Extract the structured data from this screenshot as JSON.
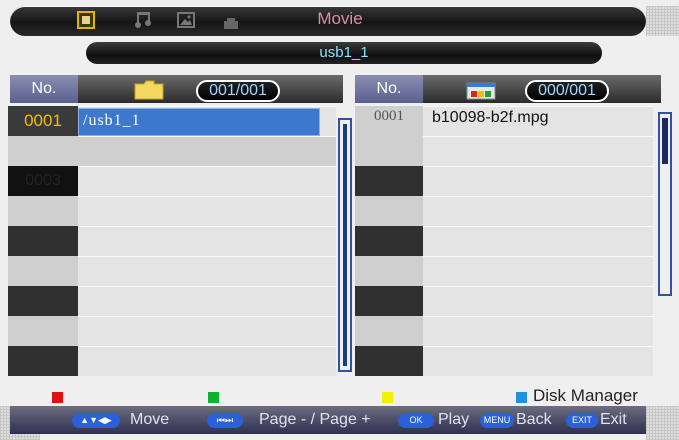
{
  "top": {
    "tabs": [
      {
        "icon": "movie-icon",
        "active": true
      },
      {
        "icon": "music-icon",
        "active": false
      },
      {
        "icon": "photo-icon",
        "active": false
      },
      {
        "icon": "text-icon",
        "active": false
      }
    ],
    "title": "Movie"
  },
  "path": "usb1_1",
  "left_panel": {
    "header_no": "No.",
    "counter": "001/001",
    "rows": [
      {
        "no": "0001",
        "name": "/usb1_1",
        "selected": true
      },
      {
        "no": "",
        "name": ""
      },
      {
        "no": "0003",
        "name": ""
      },
      {
        "no": "",
        "name": ""
      },
      {
        "no": "",
        "name": ""
      },
      {
        "no": "",
        "name": ""
      },
      {
        "no": "",
        "name": ""
      },
      {
        "no": "",
        "name": ""
      },
      {
        "no": "",
        "name": ""
      }
    ]
  },
  "right_panel": {
    "header_no": "No.",
    "counter": "000/001",
    "rows": [
      {
        "no": "0001",
        "name": "b10098-b2f.mpg"
      }
    ]
  },
  "color_keys": {
    "red": "",
    "green": "",
    "yellow": "",
    "blue": "Disk Manager"
  },
  "hints": {
    "move": "Move",
    "page": "Page - / Page +",
    "ok_key": "OK",
    "play": "Play",
    "menu_key": "MENU",
    "back": "Back",
    "exit_key": "EXIT",
    "exit": "Exit"
  },
  "colors": {
    "accent_pink": "#e08ab0",
    "path_cyan": "#8ee0ff",
    "selection_blue": "#3c78cc",
    "number_yellow": "#f0c000",
    "key_red": "#e01010",
    "key_green": "#10b030",
    "key_yellow": "#f0f000",
    "key_blue": "#2090e0"
  }
}
